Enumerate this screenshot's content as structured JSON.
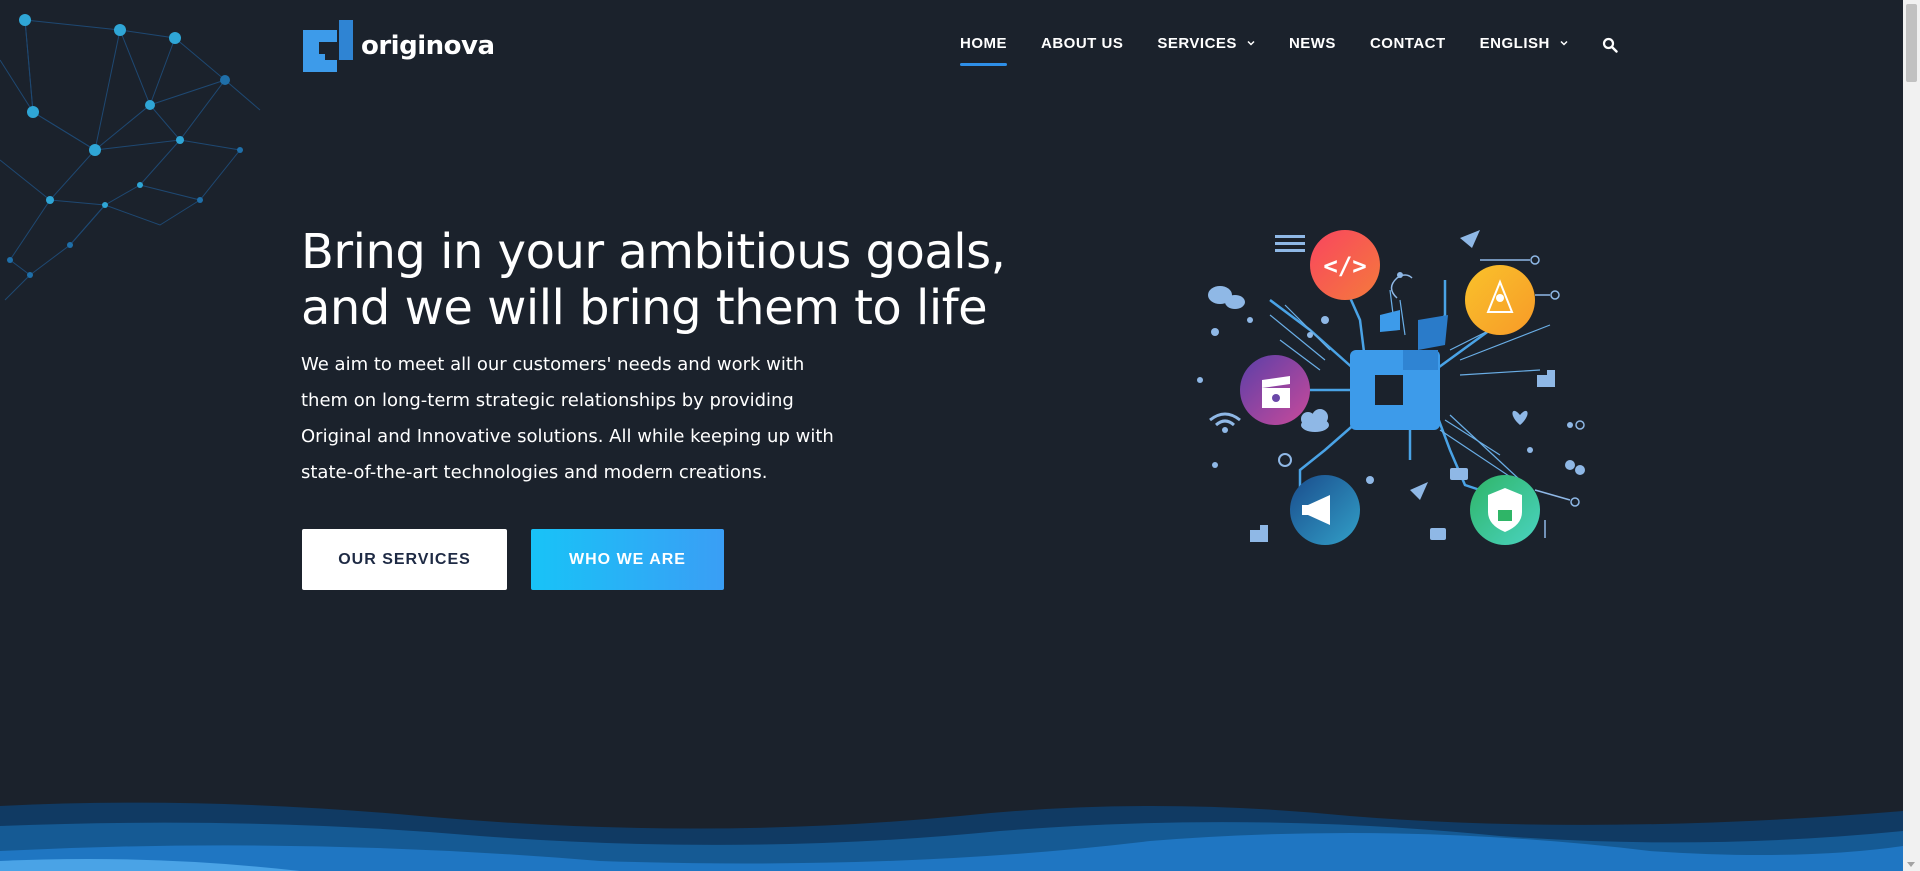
{
  "brand": {
    "name": "originova",
    "accent": "#2e8fe8",
    "logo_color": "#3d9bea"
  },
  "nav": {
    "items": [
      {
        "label": "HOME",
        "active": true
      },
      {
        "label": "ABOUT US"
      },
      {
        "label": "SERVICES",
        "dropdown": true
      },
      {
        "label": "NEWS"
      },
      {
        "label": "CONTACT"
      },
      {
        "label": "ENGLISH",
        "dropdown": true
      }
    ],
    "search_icon": "search-icon"
  },
  "hero": {
    "title_line1": "Bring in your ambitious goals,",
    "title_line2": "and we will bring them to life",
    "text_lines": [
      "We aim to meet all our customers' needs and work with",
      "them on long-term strategic relationships by providing",
      "Original and Innovative solutions. All while keeping up with",
      "state-of-the-art technologies and modern creations."
    ],
    "primary_button": "OUR SERVICES",
    "secondary_button": "WHO WE ARE"
  },
  "colors": {
    "background": "#1b222c",
    "button_gradient_start": "#18c3f7",
    "button_gradient_end": "#3a9ef5"
  }
}
